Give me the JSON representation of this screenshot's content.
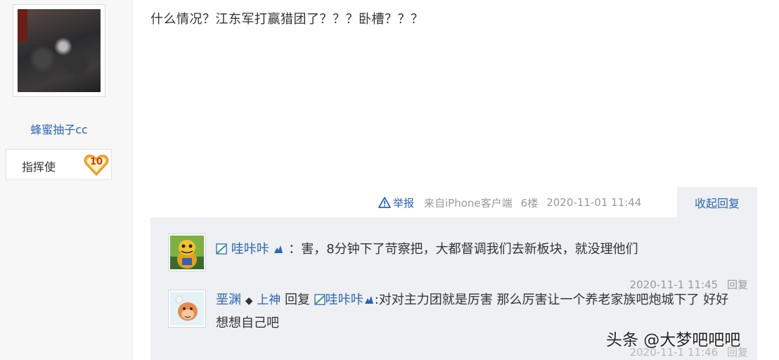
{
  "author": {
    "username": "蜂蜜抽子cc",
    "rank_title": "指挥使",
    "level": "10"
  },
  "post": {
    "content": "什么情况？江东军打赢猎团了？？？卧槽？？？"
  },
  "tail": {
    "report": "举报",
    "source": "来自iPhone客户端",
    "floor": "6楼",
    "datetime": "2020-11-01 11:44"
  },
  "collapse_label": "收起回复",
  "replies": [
    {
      "user": "哇咔咔",
      "separator": "：",
      "content": "害，8分钟下了苛察把，大都督调我们去新板块，就没理他们",
      "datetime": "2020-11-1 11:45",
      "reply_label": "回复"
    },
    {
      "user": "垩渊",
      "user_suffix": "上神",
      "reply_word": "回复",
      "reply_to": "哇咔咔",
      "content": ":对对主力团就是厉害 那么厉害让一个养老家族吧炮城下了 好好想想自己吧",
      "datetime_partial": "2020-11-1 11:46",
      "reply_label": "回复"
    }
  ],
  "watermark": "头条 @大梦吧吧吧",
  "icons": {
    "report": "warning-triangle-icon",
    "level_badge": "heart-badge-icon",
    "vip": "vip-flag-icon",
    "accent_color": "#2d64b3",
    "badge_color": "#f5b335"
  }
}
